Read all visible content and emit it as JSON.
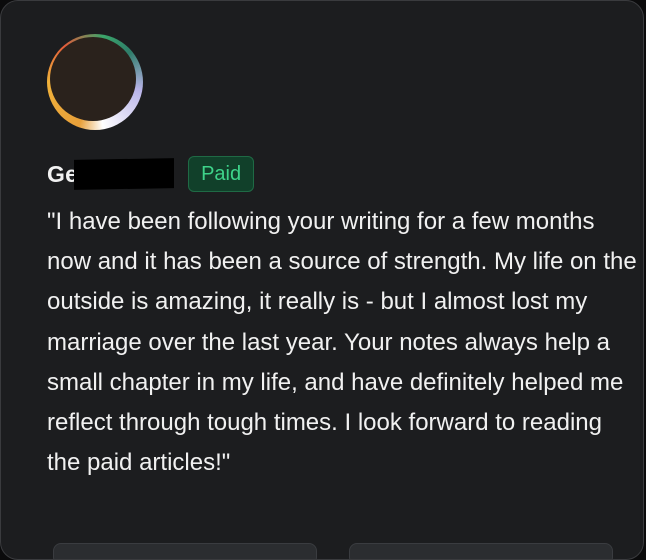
{
  "comment": {
    "author_name": "Ge",
    "badge": "Paid",
    "text": "\"I have been following your writing for a few months now and it has been a source of strength. My life on the outside is amazing, it really is - but I almost lost my marriage over the last year. Your notes always help a small chapter in my life, and have definitely helped me reflect through tough times. I look forward to reading the paid articles!\""
  },
  "colors": {
    "card_background": "#1c1d1f",
    "badge_text": "#3ed38a",
    "badge_background": "#11402a"
  },
  "icons": {
    "avatar": "user-avatar"
  }
}
